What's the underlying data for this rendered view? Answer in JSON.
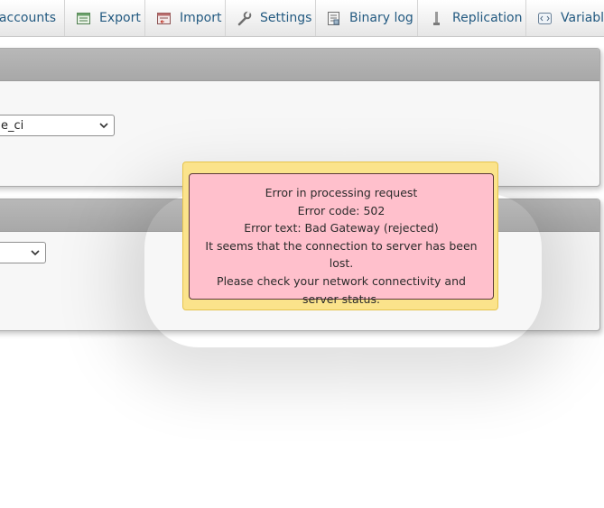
{
  "tabs": [
    {
      "label": "r accounts",
      "icon": "user-accounts-icon"
    },
    {
      "label": "Export",
      "icon": "export-icon"
    },
    {
      "label": "Import",
      "icon": "import-icon"
    },
    {
      "label": "Settings",
      "icon": "wrench-icon"
    },
    {
      "label": "Binary log",
      "icon": "binary-log-icon"
    },
    {
      "label": "Replication",
      "icon": "replication-icon"
    },
    {
      "label": "Variable",
      "icon": "variables-icon"
    }
  ],
  "panels": [
    {
      "select_value": "e_ci"
    },
    {
      "select_value": ""
    }
  ],
  "error_dialog": {
    "lines": [
      "Error in processing request",
      "Error code: 502",
      "Error text: Bad Gateway (rejected)",
      "It seems that the connection to server has been lost.",
      "Please check your network connectivity and server status."
    ]
  },
  "colors": {
    "tab_text": "#235a81",
    "dialog_outer": "#fbe38b",
    "dialog_inner": "#ffc0cc",
    "panel_header": "#b0b0b0"
  }
}
